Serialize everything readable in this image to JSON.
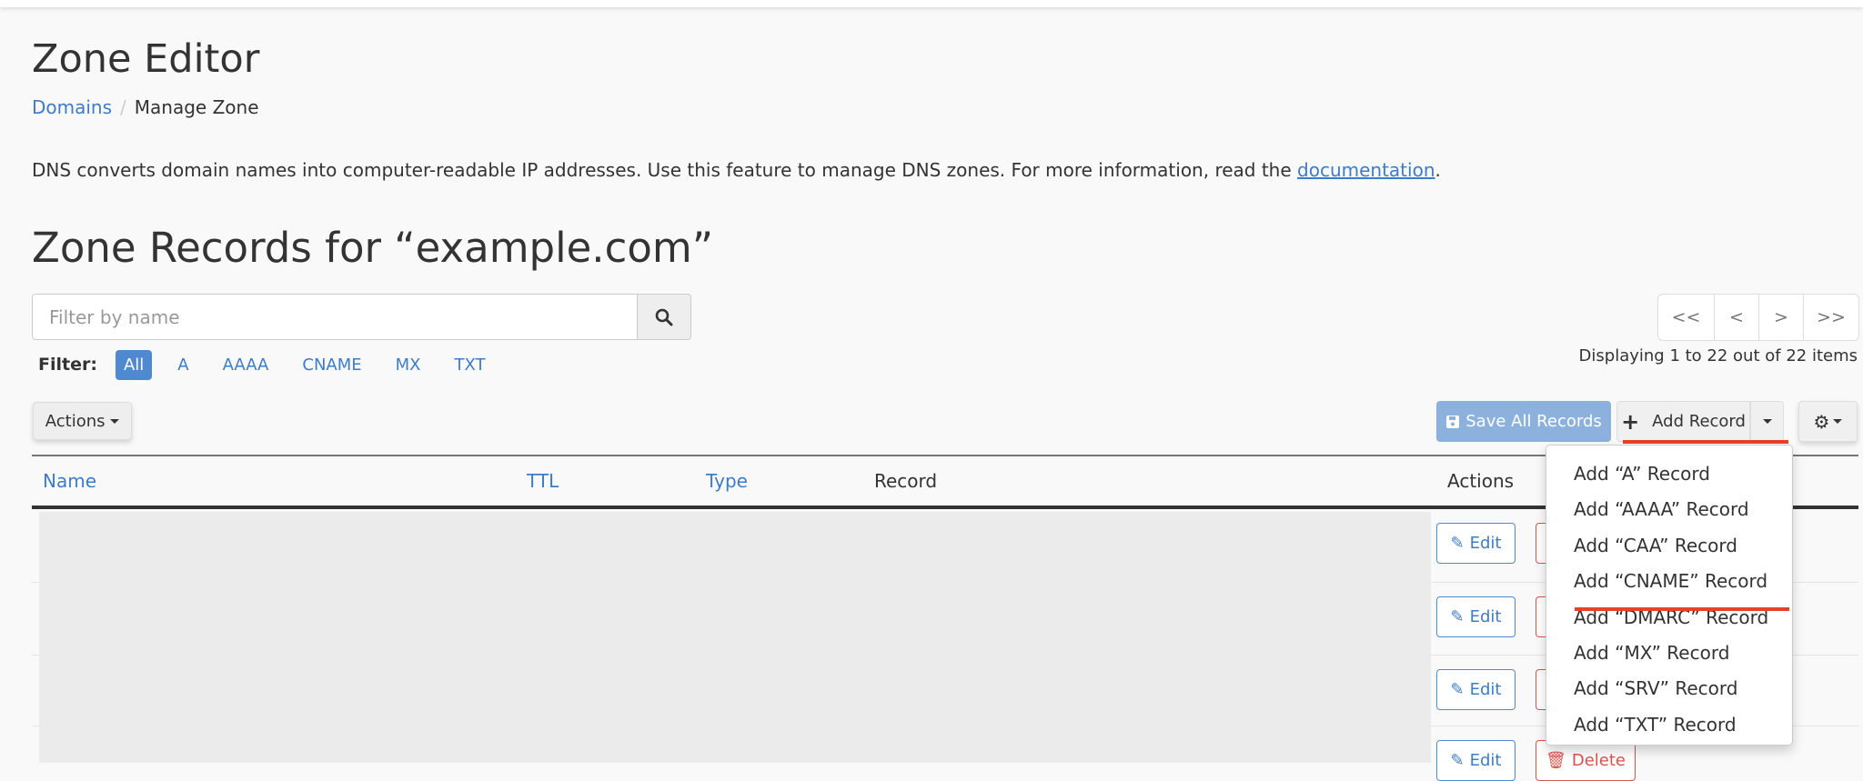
{
  "header": {
    "title": "Zone Editor",
    "breadcrumb": [
      {
        "label": "Domains"
      },
      {
        "label": "Manage Zone"
      }
    ]
  },
  "description": {
    "text": "DNS converts domain names into computer-readable IP addresses. Use this feature to manage DNS zones. For more information, read the ",
    "link": "documentation",
    "end": "."
  },
  "section_title": "Zone Records for “example.com”",
  "search": {
    "placeholder": "Filter by name",
    "value": ""
  },
  "filter": {
    "label": "Filter:",
    "options": [
      "All",
      "A",
      "AAAA",
      "CNAME",
      "MX",
      "TXT"
    ],
    "selected": "All"
  },
  "pagination": {
    "first": "<<",
    "prev": "<",
    "next": ">",
    "last": ">>",
    "status": "Displaying 1 to 22 out of 22 items"
  },
  "toolbar": {
    "actions": "Actions",
    "save_all": "Save All Records",
    "add_record": "Add Record"
  },
  "table": {
    "columns": [
      "Name",
      "TTL",
      "Type",
      "Record",
      "Actions"
    ],
    "edit": "Edit",
    "delete": "Delete"
  },
  "add_menu": [
    "Add “A” Record",
    "Add “AAAA” Record",
    "Add “CAA” Record",
    "Add “CNAME” Record",
    "Add “DMARC” Record",
    "Add “MX” Record",
    "Add “SRV” Record",
    "Add “TXT” Record"
  ],
  "colors": {
    "link": "#3d7cc7",
    "primary": "#4f8ad0",
    "danger": "#d9534f",
    "annotation": "#e8412a"
  }
}
